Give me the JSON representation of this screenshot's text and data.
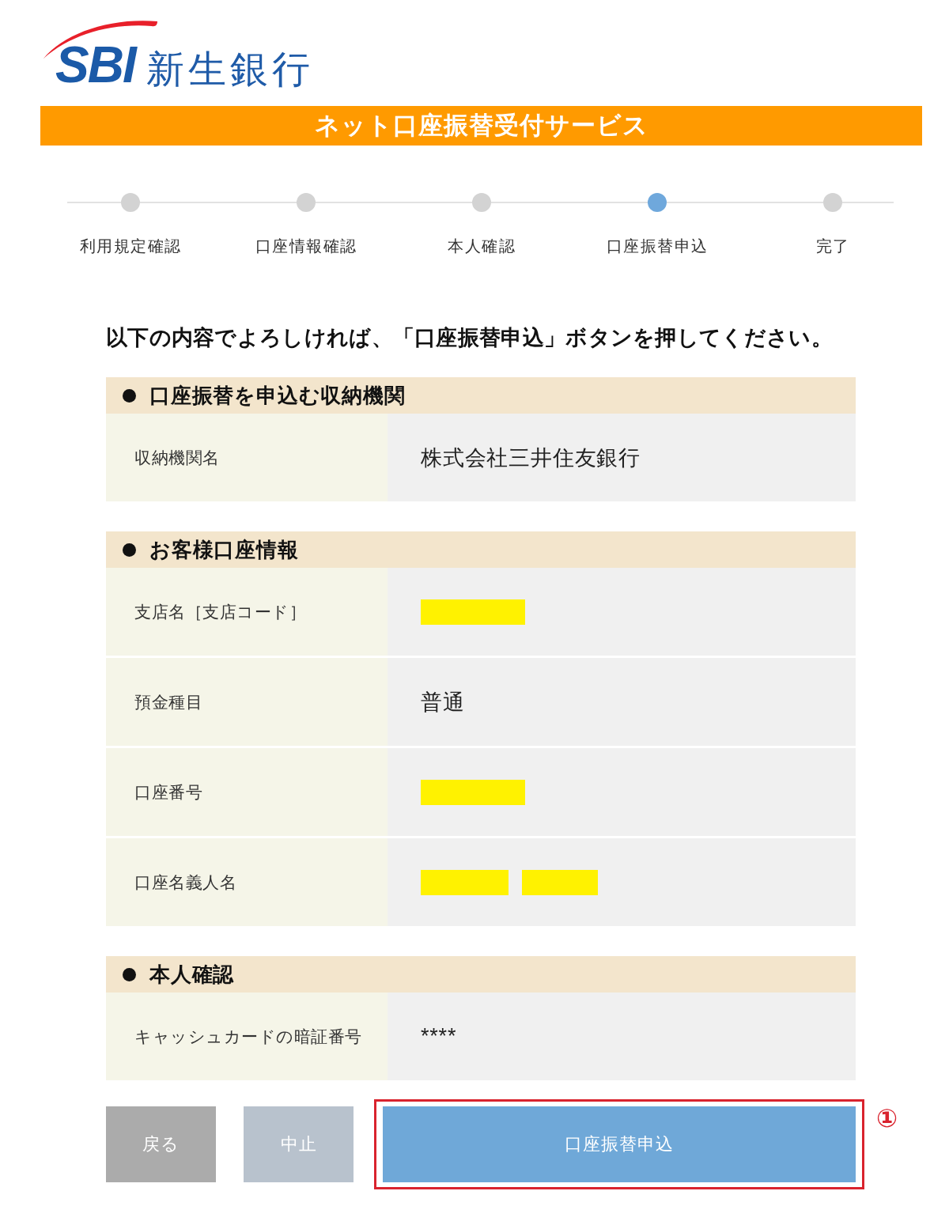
{
  "logo": {
    "mark": "SBI",
    "name": "新生銀行"
  },
  "banner": {
    "title": "ネット口座振替受付サービス"
  },
  "steps": [
    {
      "label": "利用規定確認",
      "selected": false
    },
    {
      "label": "口座情報確認",
      "selected": false
    },
    {
      "label": "本人確認",
      "selected": false
    },
    {
      "label": "口座振替申込",
      "selected": true
    },
    {
      "label": "完了",
      "selected": false
    }
  ],
  "instruction": "以下の内容でよろしければ、「口座振替申込」ボタンを押してください。",
  "sections": [
    {
      "title": "口座振替を申込む収納機関",
      "rows": [
        {
          "label": "収納機関名",
          "value": "株式会社三井住友銀行"
        }
      ]
    },
    {
      "title": "お客様口座情報",
      "rows": [
        {
          "label": "支店名［支店コード］",
          "value_blocks": [
            {
              "redacted": true
            }
          ]
        },
        {
          "label": "預金種目",
          "value": "普通"
        },
        {
          "label": "口座番号",
          "value_blocks": [
            {
              "redacted": true
            }
          ]
        },
        {
          "label": "口座名義人名",
          "value_blocks": [
            {
              "redacted": true
            },
            {
              "redacted": true
            }
          ]
        }
      ]
    },
    {
      "title": "本人確認",
      "rows": [
        {
          "label": "キャッシュカードの暗証番号",
          "value": "****"
        }
      ]
    }
  ],
  "buttons": [
    {
      "kind": "back",
      "label": "戻る"
    },
    {
      "kind": "cancel",
      "label": "中止"
    },
    {
      "kind": "primary",
      "label": "口座振替申込",
      "highlighted": true,
      "callout": "①"
    }
  ]
}
